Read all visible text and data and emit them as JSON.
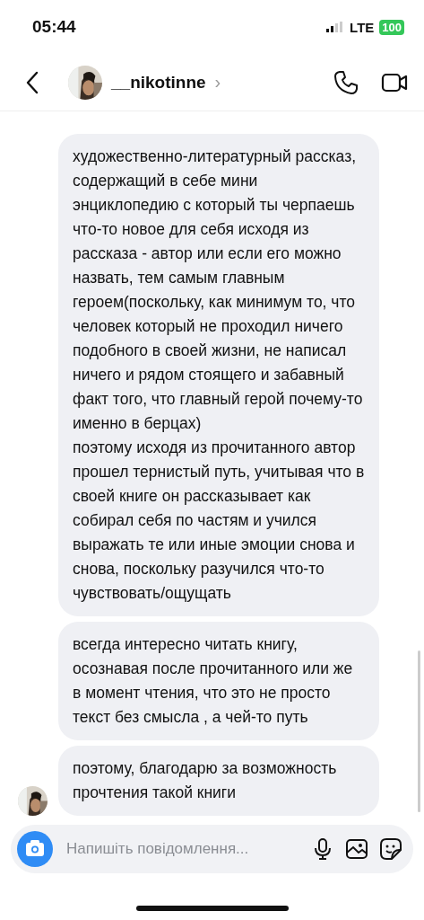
{
  "status_bar": {
    "time": "05:44",
    "network": "LTE",
    "battery": "100"
  },
  "header": {
    "username": "__nikotinne",
    "chevron": "›"
  },
  "messages": [
    {
      "text": "художественно-литературный рассказ, содержащий в себе мини энциклопедию с который ты черпаешь что-то новое для себя исходя из рассказа - автор или если его можно назвать, тем самым главным героем(поскольку, как минимум то, что человек который не проходил ничего подобного в своей жизни, не написал ничего и рядом стоящего и забавный факт того, что главный герой почему-то именно в берцах)\nпоэтому исходя из прочитанного автор прошел тернистый путь, учитывая что в своей книге он рассказывает как собирал себя по частям и учился выражать те или иные эмоции снова и снова, поскольку разучился что-то чувствовать/ощущать",
      "show_avatar": false
    },
    {
      "text": "всегда интересно читать книгу, осознавая после прочитанного или же в момент чтения, что это не просто текст без смысла , а чей-то путь",
      "show_avatar": false
    },
    {
      "text": "поэтому, благодарю за возможность прочтения такой книги",
      "show_avatar": true
    }
  ],
  "composer": {
    "placeholder": "Напишіть повідомлення..."
  }
}
